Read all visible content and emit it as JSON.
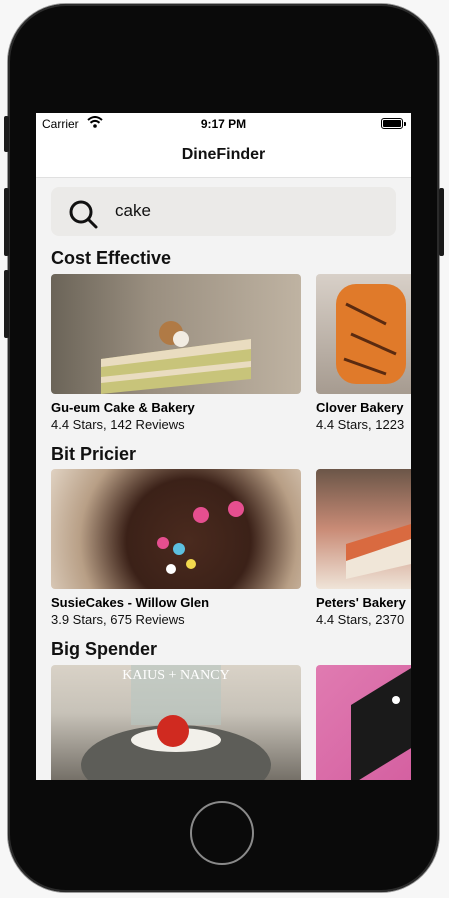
{
  "status_bar": {
    "carrier": "Carrier",
    "time": "9:17 PM"
  },
  "nav": {
    "title": "DineFinder"
  },
  "search": {
    "value": "cake",
    "icon": "search-icon"
  },
  "sections": [
    {
      "title": "Cost Effective",
      "items": [
        {
          "name": "Gu-eum Cake & Bakery",
          "meta": "4.4 Stars, 142 Reviews"
        },
        {
          "name": "Clover Bakery",
          "meta": "4.4 Stars, 1223"
        }
      ]
    },
    {
      "title": "Bit Pricier",
      "items": [
        {
          "name": "SusieCakes - Willow Glen",
          "meta": "3.9 Stars, 675 Reviews"
        },
        {
          "name": "Peters' Bakery",
          "meta": "4.4 Stars, 2370"
        }
      ]
    },
    {
      "title": "Big Spender",
      "items": [
        {
          "name": "",
          "meta": ""
        },
        {
          "name": "",
          "meta": ""
        }
      ],
      "image_text": "KAIUS + NANCY"
    }
  ]
}
